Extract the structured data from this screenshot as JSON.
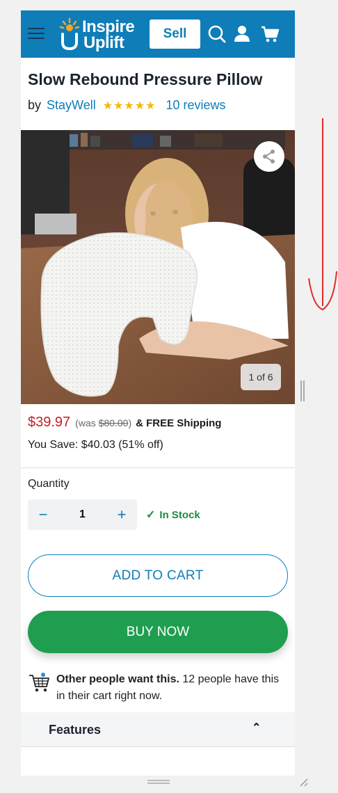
{
  "header": {
    "logo_line1": "Inspire",
    "logo_line2": "Uplift",
    "sell_label": "Sell",
    "accent_color": "#0e7db8",
    "icons": [
      "menu-icon",
      "search-icon",
      "user-icon",
      "cart-icon"
    ]
  },
  "product": {
    "title": "Slow Rebound Pressure Pillow",
    "by_label": "by",
    "brand": "StayWell",
    "rating": 4.5,
    "stars": "★★★★★",
    "reviews": "10 reviews"
  },
  "gallery": {
    "counter": "1 of 6",
    "share_icon": "share-icon"
  },
  "pricing": {
    "price": "$39.97",
    "was_open": "(was",
    "was_price": "$80.00",
    "was_close": ")",
    "shipping": "& FREE Shipping",
    "you_save": "You Save: $40.03 (51% off)",
    "price_color": "#c21f24"
  },
  "quantity": {
    "label": "Quantity",
    "minus": "−",
    "value": "1",
    "plus": "+",
    "stock": "In Stock"
  },
  "actions": {
    "add_to_cart": "ADD TO CART",
    "buy_now": "BUY NOW",
    "buy_color": "#1f9e50"
  },
  "social": {
    "bold": "Other people want this.",
    "rest": " 12 people have this in their cart right now."
  },
  "features": {
    "title": "Features",
    "chevron": "⌃"
  }
}
